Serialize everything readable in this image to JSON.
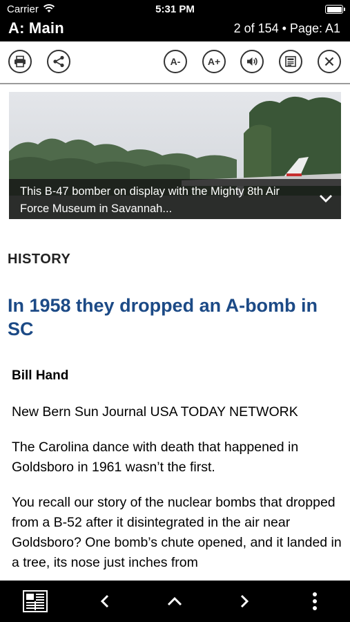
{
  "status_bar": {
    "carrier": "Carrier",
    "time": "5:31 PM"
  },
  "header": {
    "title": "A: Main",
    "page_info": "2 of 154 • Page: A1"
  },
  "toolbar": {
    "font_smaller": "A-",
    "font_larger": "A+"
  },
  "image": {
    "caption": "This B-47 bomber on display with the Mighty 8th Air Force Museum in Savannah..."
  },
  "article": {
    "section": "HISTORY",
    "headline": "In 1958 they dropped an A-bomb in SC",
    "author": "Bill Hand",
    "paragraphs": [
      "New Bern Sun Journal USA TODAY NETWORK",
      "The Carolina dance with death that happened in Goldsboro in 1961 wasn’t the first.",
      "You recall our story of the nuclear bombs that dropped from a B-52 after it disintegrated in the air near Goldsboro? One bomb’s chute opened, and it landed in a tree, its nose just inches from"
    ]
  },
  "colors": {
    "headline": "#1c4a86",
    "bars": "#000000"
  }
}
